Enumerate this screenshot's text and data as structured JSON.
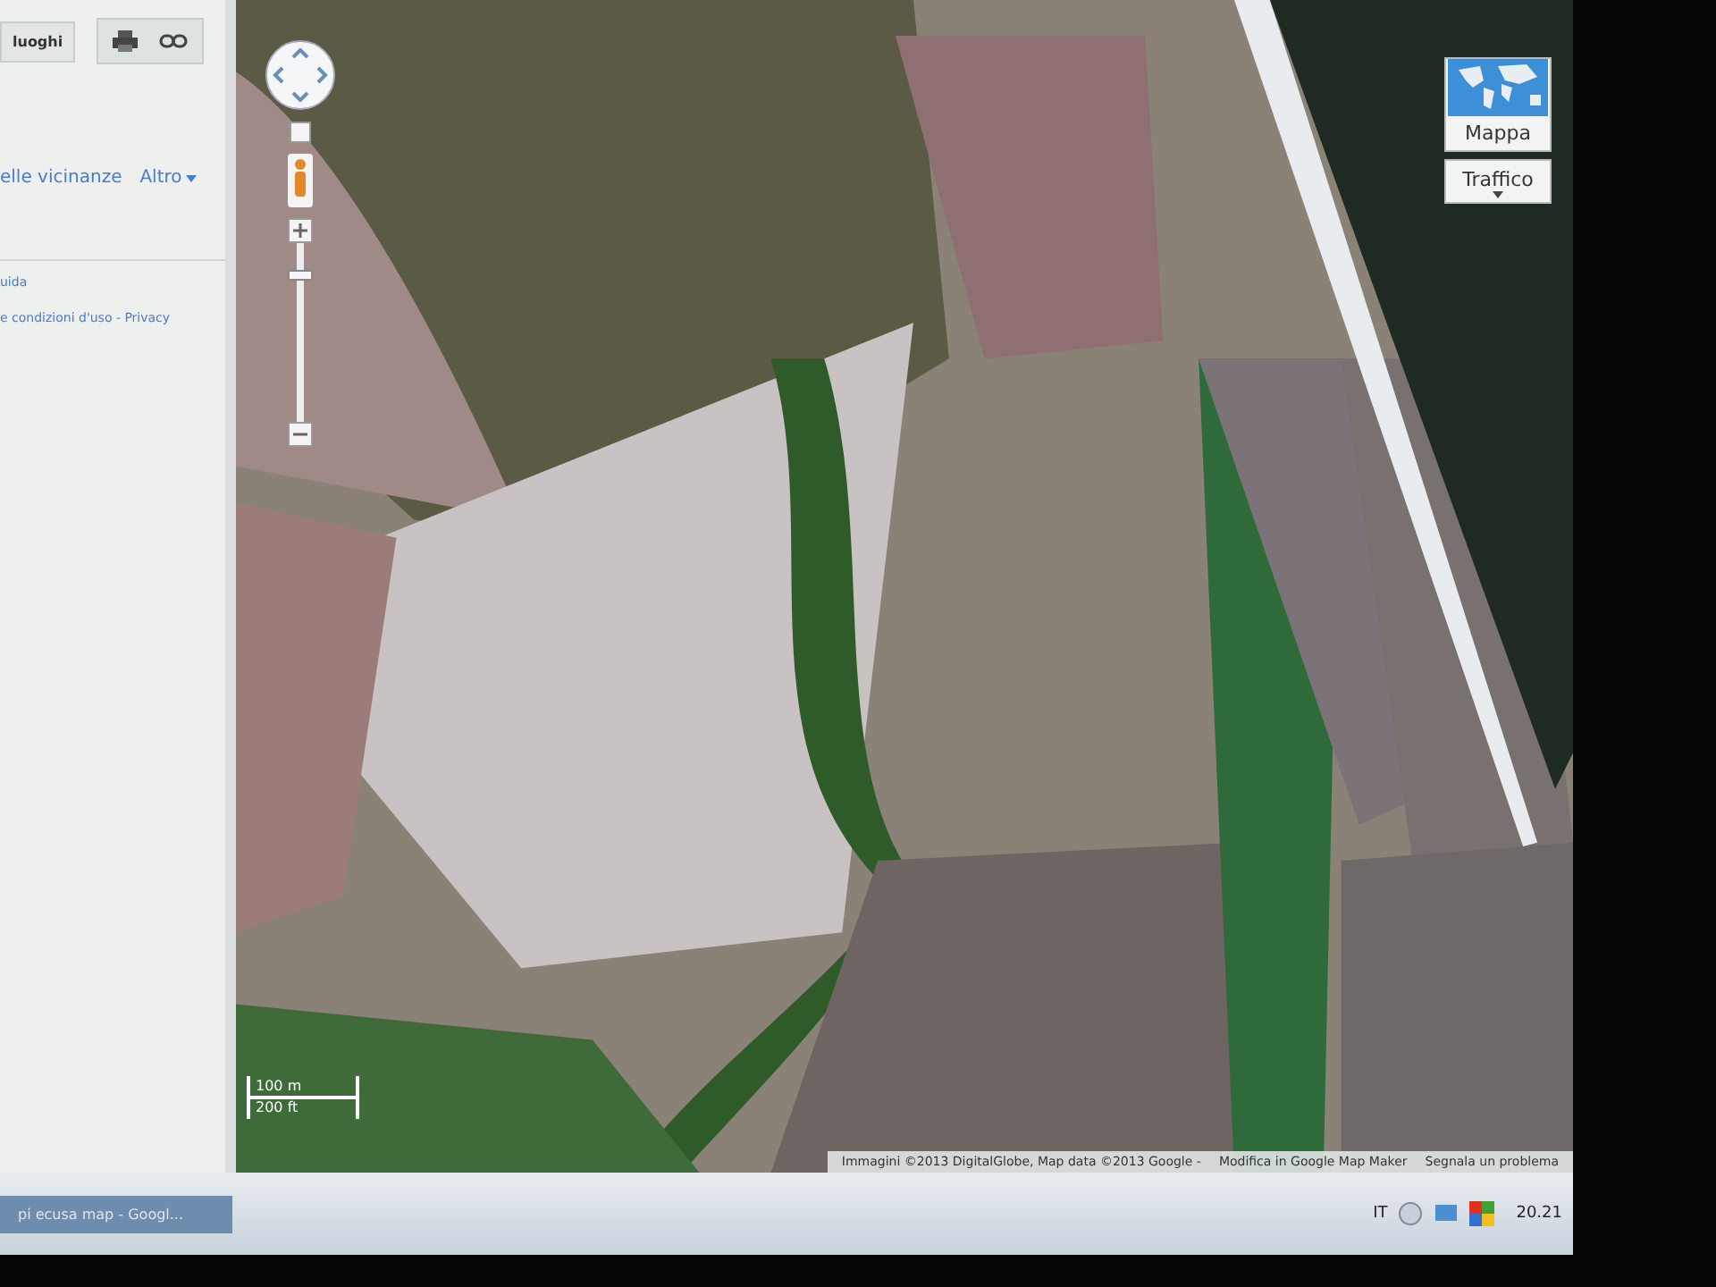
{
  "sidebar": {
    "button": "luoghi",
    "links": [
      {
        "kind": "link",
        "label": "elle vicinanze"
      },
      {
        "kind": "menu",
        "label": "Altro"
      }
    ],
    "footer": [
      "uida",
      "e condizioni d'uso - Privacy"
    ]
  },
  "map": {
    "zoom_slider": {
      "level": 0.82
    },
    "map_types": [
      {
        "label": "Mappa",
        "kind": "thumb"
      },
      {
        "label": "Traffico",
        "kind": "menu"
      }
    ],
    "scale": [
      "100 m",
      "200 ft"
    ],
    "attribution": "Immagini ©2013 DigitalGlobe, Map data ©2013 Google -",
    "links": [
      "Modifica in Google Map Maker",
      "Segnala un problema"
    ]
  },
  "taskbar": {
    "window": "pi ecusa map - Googl...",
    "language": "IT",
    "clock": "20.21"
  }
}
